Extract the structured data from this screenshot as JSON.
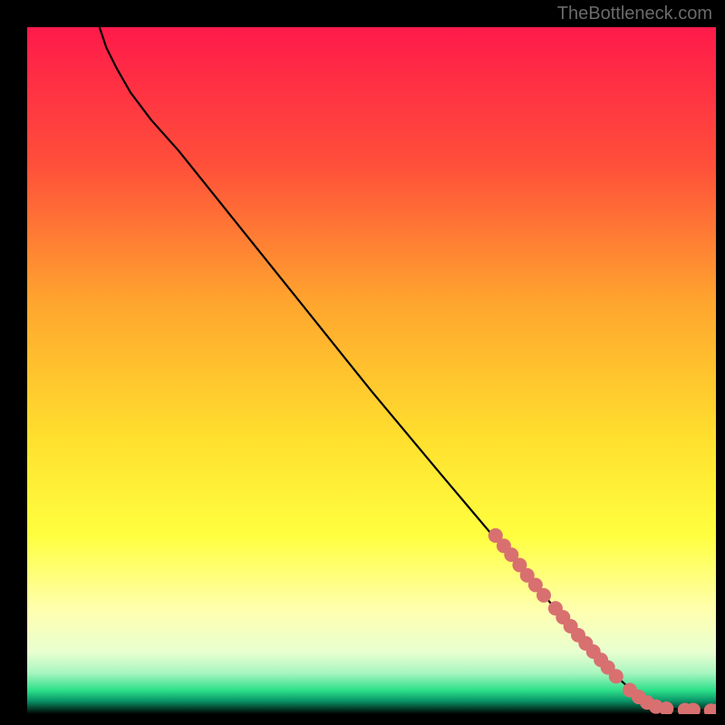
{
  "watermark": "TheBottleneck.com",
  "chart_data": {
    "type": "line",
    "title": "",
    "xlabel": "",
    "ylabel": "",
    "xlim": [
      0,
      100
    ],
    "ylim": [
      0,
      100
    ],
    "background_gradient": {
      "stops": [
        {
          "offset": 0,
          "color": "#ff1a4a"
        },
        {
          "offset": 20,
          "color": "#ff4f3a"
        },
        {
          "offset": 40,
          "color": "#ffa52e"
        },
        {
          "offset": 60,
          "color": "#ffe02e"
        },
        {
          "offset": 74,
          "color": "#ffff3f"
        },
        {
          "offset": 85,
          "color": "#ffffb0"
        },
        {
          "offset": 91,
          "color": "#e8ffd0"
        },
        {
          "offset": 94,
          "color": "#a8f5c0"
        },
        {
          "offset": 96.5,
          "color": "#2ee08a"
        },
        {
          "offset": 98,
          "color": "#0a9a6a"
        },
        {
          "offset": 100,
          "color": "#000000"
        }
      ]
    },
    "curve": [
      {
        "x": 10.5,
        "y": 100
      },
      {
        "x": 11.5,
        "y": 97
      },
      {
        "x": 13.0,
        "y": 94
      },
      {
        "x": 15.0,
        "y": 90.5
      },
      {
        "x": 18.0,
        "y": 86.5
      },
      {
        "x": 22.0,
        "y": 82
      },
      {
        "x": 26.0,
        "y": 77
      },
      {
        "x": 32.0,
        "y": 69.5
      },
      {
        "x": 40.0,
        "y": 59.5
      },
      {
        "x": 50.0,
        "y": 47
      },
      {
        "x": 60.0,
        "y": 35
      },
      {
        "x": 68.0,
        "y": 25.5
      },
      {
        "x": 74.0,
        "y": 18.5
      },
      {
        "x": 80.0,
        "y": 11.5
      },
      {
        "x": 85.0,
        "y": 6
      },
      {
        "x": 88.5,
        "y": 2.8
      },
      {
        "x": 91.0,
        "y": 1.3
      },
      {
        "x": 93.0,
        "y": 0.8
      },
      {
        "x": 96.0,
        "y": 0.6
      },
      {
        "x": 100.0,
        "y": 0.5
      }
    ],
    "points": [
      {
        "x": 68.0,
        "y": 26.0
      },
      {
        "x": 69.2,
        "y": 24.5
      },
      {
        "x": 70.3,
        "y": 23.2
      },
      {
        "x": 71.5,
        "y": 21.7
      },
      {
        "x": 72.6,
        "y": 20.2
      },
      {
        "x": 73.8,
        "y": 18.8
      },
      {
        "x": 75.0,
        "y": 17.3
      },
      {
        "x": 76.7,
        "y": 15.4
      },
      {
        "x": 77.8,
        "y": 14.1
      },
      {
        "x": 78.9,
        "y": 12.8
      },
      {
        "x": 80.0,
        "y": 11.5
      },
      {
        "x": 81.1,
        "y": 10.3
      },
      {
        "x": 82.2,
        "y": 9.1
      },
      {
        "x": 83.3,
        "y": 7.9
      },
      {
        "x": 84.3,
        "y": 6.8
      },
      {
        "x": 85.5,
        "y": 5.5
      },
      {
        "x": 87.5,
        "y": 3.5
      },
      {
        "x": 88.8,
        "y": 2.5
      },
      {
        "x": 90.0,
        "y": 1.7
      },
      {
        "x": 91.3,
        "y": 1.1
      },
      {
        "x": 92.8,
        "y": 0.8
      },
      {
        "x": 95.5,
        "y": 0.6
      },
      {
        "x": 96.7,
        "y": 0.6
      },
      {
        "x": 99.3,
        "y": 0.5
      },
      {
        "x": 100.3,
        "y": 0.5
      }
    ],
    "point_color": "#d87070",
    "curve_color": "#000000"
  }
}
